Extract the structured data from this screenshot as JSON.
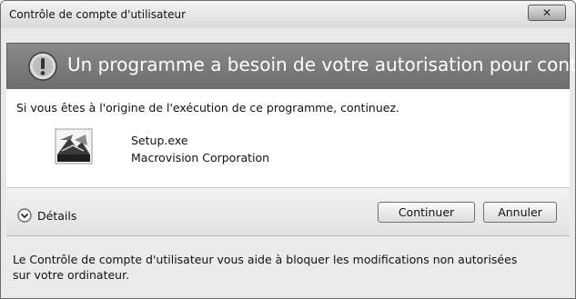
{
  "window": {
    "title": "Contrôle de compte d'utilisateur",
    "close_label": "✕"
  },
  "banner": {
    "icon": "shield-warning-icon",
    "text": "Un programme a besoin de votre autorisation pour continuer."
  },
  "content": {
    "intro": "Si vous êtes à l'origine de l'exécution de ce programme, continuez.",
    "program": {
      "icon": "setup-program-icon",
      "name": "Setup.exe",
      "publisher": "Macrovision Corporation"
    }
  },
  "actions": {
    "details_icon": "chevron-down-circle-icon",
    "details_label": "Détails",
    "continue_label": "Continuer",
    "cancel_label": "Annuler"
  },
  "footer": {
    "text": "Le Contrôle de compte d'utilisateur vous aide à bloquer les modifications non autorisées sur votre ordinateur."
  },
  "colors": {
    "banner_background": "#7a7a7a",
    "content_background": "#ffffff",
    "window_frame": "#e9e9e9"
  }
}
